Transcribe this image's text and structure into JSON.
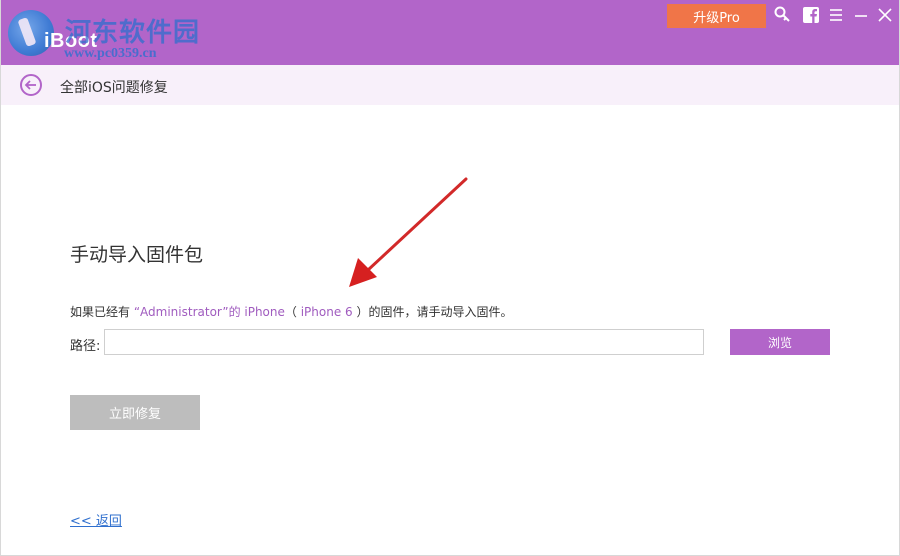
{
  "app": {
    "name": "iBoot",
    "watermark_title": "河东软件园",
    "watermark_url": "www.pc0359.cn"
  },
  "titlebar": {
    "upgrade_label": "升级Pro",
    "icons": [
      "key-icon",
      "facebook-icon",
      "menu-icon",
      "minimize-icon",
      "close-icon"
    ]
  },
  "subheader": {
    "title": "全部iOS问题修复"
  },
  "main": {
    "heading": "手动导入固件包",
    "desc": {
      "prefix": "如果已经有 ",
      "user": "“Administrator”的 iPhone",
      "paren_open": "（ ",
      "model": "iPhone 6",
      "paren_close": " ）",
      "suffix": "的固件，请手动导入固件。"
    },
    "path_label": "路径:",
    "path_value": "",
    "browse_label": "浏览",
    "repair_label": "立即修复",
    "return_label": "<< 返回"
  },
  "colors": {
    "brand": "#b265c9",
    "upgrade": "#f07548",
    "disabled": "#bdbdbd",
    "link": "#2f6fce",
    "annotation_arrow": "#d62020"
  }
}
